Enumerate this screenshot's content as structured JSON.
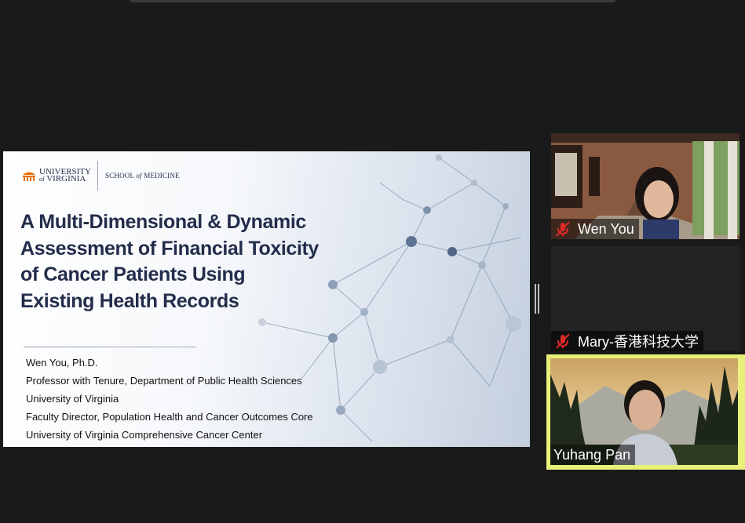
{
  "slide": {
    "logo_university": "UNIVERSITY",
    "logo_of": "of",
    "logo_virginia": "VIRGINIA",
    "logo_school_pre": "SCHOOL",
    "logo_school_of": "of",
    "logo_school_post": "MEDICINE",
    "title_lines": [
      "A Multi-Dimensional & Dynamic",
      "Assessment of Financial Toxicity",
      "of Cancer Patients Using",
      "Existing Health Records"
    ],
    "credits": [
      "Wen You, Ph.D.",
      "Professor with Tenure, Department of Public Health Sciences",
      "University of Virginia",
      "Faculty Director, Population Health and Cancer Outcomes Core",
      "University of Virginia Comprehensive Cancer Center"
    ]
  },
  "participants": [
    {
      "name": "Wen You",
      "muted": true,
      "icon": "mic-muted-icon"
    },
    {
      "name": "Mary-香港科技大学",
      "muted": true,
      "icon": "mic-muted-icon"
    },
    {
      "name": "Yuhang Pan",
      "muted": false,
      "active_speaker": true
    }
  ],
  "colors": {
    "background": "#1a1a1a",
    "title_navy": "#232d4b",
    "active_speaker_border": "#e8f079",
    "muted_red": "#e02828"
  }
}
